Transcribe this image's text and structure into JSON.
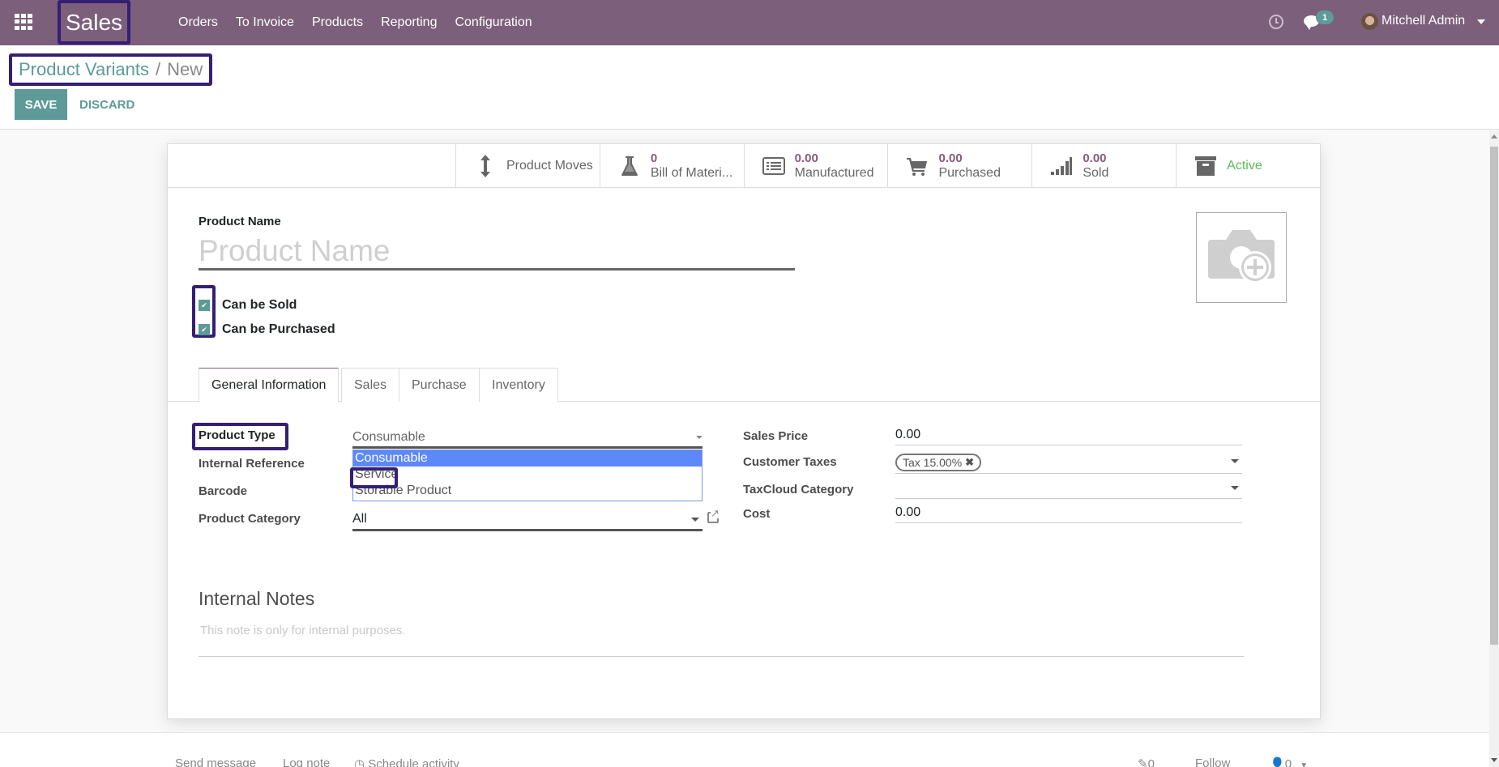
{
  "navbar": {
    "app_name": "Sales",
    "menu": [
      "Orders",
      "To Invoice",
      "Products",
      "Reporting",
      "Configuration"
    ],
    "message_count": "1",
    "user_name": "Mitchell Admin"
  },
  "breadcrumb": {
    "parent": "Product Variants",
    "separator": "/",
    "current": "New"
  },
  "actions": {
    "save_label": "SAVE",
    "discard_label": "DISCARD"
  },
  "stat_buttons": {
    "product_moves": {
      "label": "Product Moves",
      "icon": "arrows-v-icon"
    },
    "bom": {
      "value": "0",
      "label": "Bill of Materi...",
      "icon": "flask-icon"
    },
    "manufactured": {
      "value": "0.00",
      "label": "Manufactured",
      "icon": "list-alt-icon"
    },
    "purchased": {
      "value": "0.00",
      "label": "Purchased",
      "icon": "cart-icon"
    },
    "sold": {
      "value": "0.00",
      "label": "Sold",
      "icon": "signal-icon"
    },
    "active": {
      "label": "Active",
      "icon": "archive-icon"
    }
  },
  "form": {
    "product_name_label": "Product Name",
    "product_name_placeholder": "Product Name",
    "can_be_sold": {
      "label": "Can be Sold",
      "checked": true
    },
    "can_be_purchased": {
      "label": "Can be Purchased",
      "checked": true
    },
    "image_icon": "camera-plus-icon"
  },
  "tabs": [
    "General Information",
    "Sales",
    "Purchase",
    "Inventory"
  ],
  "active_tab": "General Information",
  "general": {
    "left": {
      "product_type_label": "Product Type",
      "product_type_value": "Consumable",
      "product_type_options": [
        "Consumable",
        "Service",
        "Storable Product"
      ],
      "product_type_highlighted_option": "Consumable",
      "internal_reference_label": "Internal Reference",
      "barcode_label": "Barcode",
      "product_category_label": "Product Category",
      "product_category_value": "All"
    },
    "right": {
      "sales_price_label": "Sales Price",
      "sales_price_value": "0.00",
      "customer_taxes_label": "Customer Taxes",
      "customer_taxes_tag": "Tax 15.00%",
      "taxcloud_category_label": "TaxCloud Category",
      "taxcloud_category_value": "",
      "cost_label": "Cost",
      "cost_value": "0.00"
    },
    "notes_title": "Internal Notes",
    "notes_placeholder": "This note is only for internal purposes."
  },
  "chatter": {
    "send_message": "Send message",
    "log_note": "Log note",
    "schedule_activity": "Schedule activity",
    "attachments_count": "0",
    "follow": "Follow",
    "followers_count": "0"
  },
  "colors": {
    "navbar": "#7c5f7b",
    "primary": "#5d9a98",
    "stat_value": "#875a7b",
    "active": "#5cb85c",
    "highlight_box": "#351f74",
    "dropdown_selected": "#5d88fa"
  }
}
